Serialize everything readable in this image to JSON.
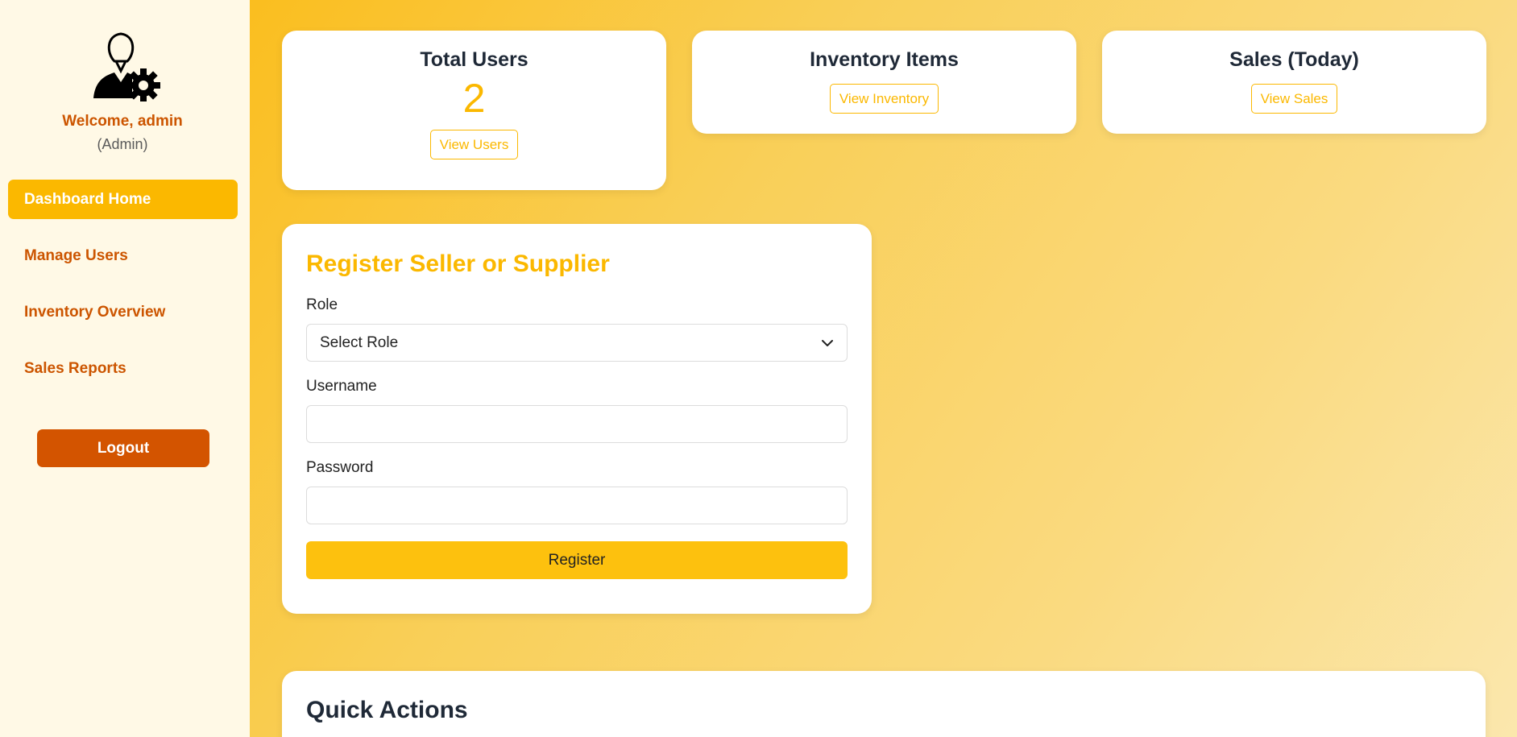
{
  "sidebar": {
    "avatar_icon": "admin-settings-icon",
    "welcome": "Welcome, admin",
    "role": "(Admin)",
    "nav": [
      {
        "label": "Dashboard Home",
        "active": true
      },
      {
        "label": "Manage Users",
        "active": false
      },
      {
        "label": "Inventory Overview",
        "active": false
      },
      {
        "label": "Sales Reports",
        "active": false
      }
    ],
    "logout_label": "Logout"
  },
  "stats": {
    "users": {
      "title": "Total Users",
      "value": "2",
      "button": "View Users"
    },
    "inventory": {
      "title": "Inventory Items",
      "button": "View Inventory"
    },
    "sales": {
      "title": "Sales (Today)",
      "button": "View Sales"
    }
  },
  "register": {
    "title": "Register Seller or Supplier",
    "role_label": "Role",
    "role_selected": "Select Role",
    "username_label": "Username",
    "username_value": "",
    "password_label": "Password",
    "password_value": "",
    "submit_label": "Register"
  },
  "quick_actions": {
    "title": "Quick Actions"
  },
  "colors": {
    "accent": "#fbb800",
    "brand_dark": "#d35400",
    "text_orange": "#cc5500",
    "sidebar_bg": "#fff9e6"
  }
}
